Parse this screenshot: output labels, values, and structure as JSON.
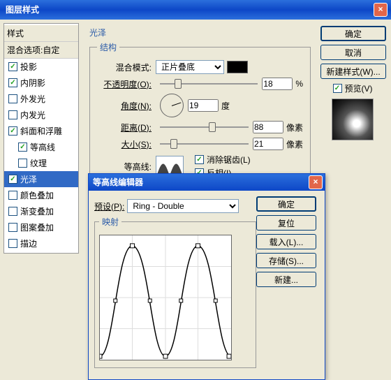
{
  "window": {
    "title": "图层样式"
  },
  "buttons": {
    "ok": "确定",
    "cancel": "取消",
    "newstyle": "新建样式(W)...",
    "preview": "预览(V)"
  },
  "styles": {
    "header1": "样式",
    "header2": "混合选项:自定",
    "items": [
      {
        "label": "投影",
        "checked": true,
        "indent": false
      },
      {
        "label": "内阴影",
        "checked": true,
        "indent": false
      },
      {
        "label": "外发光",
        "checked": false,
        "indent": false
      },
      {
        "label": "内发光",
        "checked": false,
        "indent": false
      },
      {
        "label": "斜面和浮雕",
        "checked": true,
        "indent": false
      },
      {
        "label": "等高线",
        "checked": true,
        "indent": true
      },
      {
        "label": "纹理",
        "checked": false,
        "indent": true
      },
      {
        "label": "光泽",
        "checked": true,
        "selected": true,
        "indent": false
      },
      {
        "label": "颜色叠加",
        "checked": false,
        "indent": false
      },
      {
        "label": "渐变叠加",
        "checked": false,
        "indent": false
      },
      {
        "label": "图案叠加",
        "checked": false,
        "indent": false
      },
      {
        "label": "描边",
        "checked": false,
        "indent": false
      }
    ]
  },
  "satin": {
    "title": "光泽",
    "structure": "结构",
    "blend_label": "混合模式:",
    "blend_value": "正片叠底",
    "opacity_label": "不透明度(O):",
    "opacity_value": "18",
    "opacity_unit": "%",
    "angle_label": "角度(N):",
    "angle_value": "19",
    "angle_unit": "度",
    "distance_label": "距离(D):",
    "distance_value": "88",
    "distance_unit": "像素",
    "size_label": "大小(S):",
    "size_value": "21",
    "size_unit": "像素",
    "contour_label": "等高线:",
    "anti_label": "消除锯齿(L)",
    "invert_label": "反相(I)"
  },
  "editor": {
    "title": "等高线编辑器",
    "preset_label": "预设(P):",
    "preset_value": "Ring - Double",
    "mapping": "映射",
    "ok": "确定",
    "reset": "复位",
    "load": "载入(L)...",
    "save": "存储(S)...",
    "new": "新建..."
  }
}
